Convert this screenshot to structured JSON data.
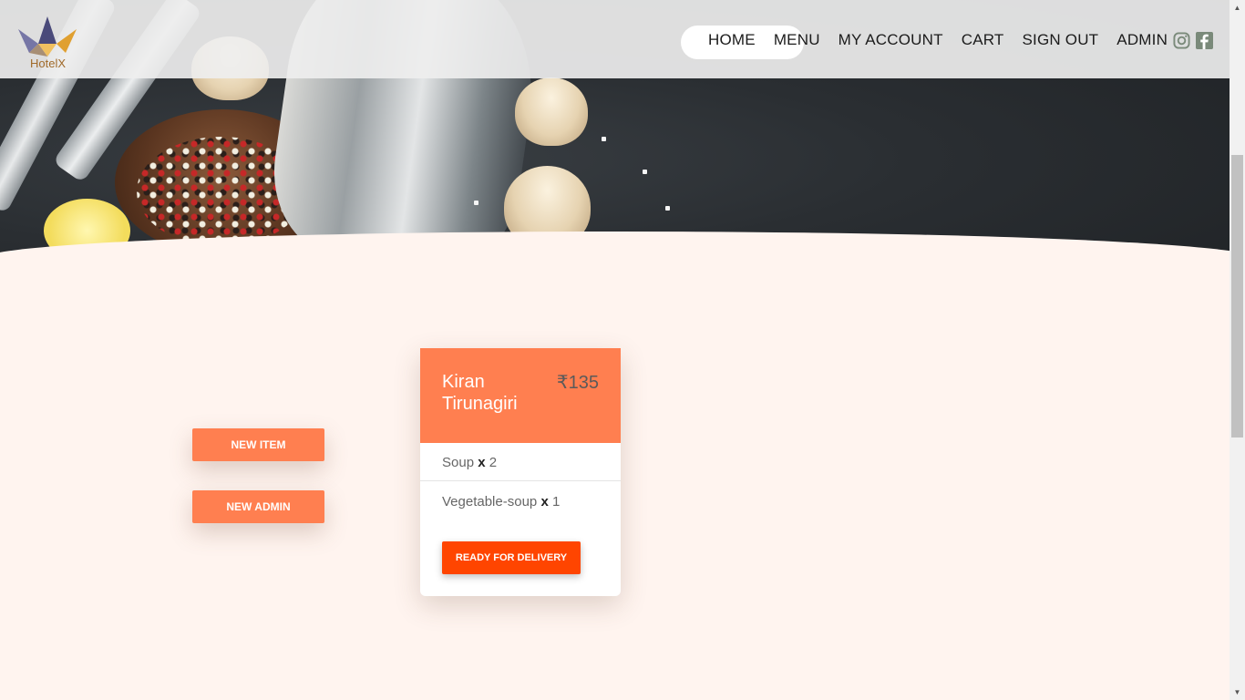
{
  "brand": {
    "name": "HotelX"
  },
  "nav": {
    "items": [
      "HOME",
      "MENU",
      "MY ACCOUNT",
      "CART",
      "SIGN OUT",
      "ADMIN"
    ]
  },
  "social": {
    "icons": [
      "instagram-icon",
      "facebook-icon"
    ]
  },
  "admin_actions": {
    "new_item_label": "NEW ITEM",
    "new_admin_label": "NEW ADMIN"
  },
  "orders": [
    {
      "customer": "Kiran Tirunagiri",
      "total": "₹135",
      "items": [
        {
          "name": "Soup",
          "x": "x",
          "qty": "2"
        },
        {
          "name": "Vegetable-soup",
          "x": "x",
          "qty": "1"
        }
      ],
      "action_label": "READY FOR DELIVERY"
    }
  ],
  "colors": {
    "accent": "#ff7f50",
    "action": "#ff4500",
    "background": "#fff4ef",
    "header": "#eeeeee"
  }
}
